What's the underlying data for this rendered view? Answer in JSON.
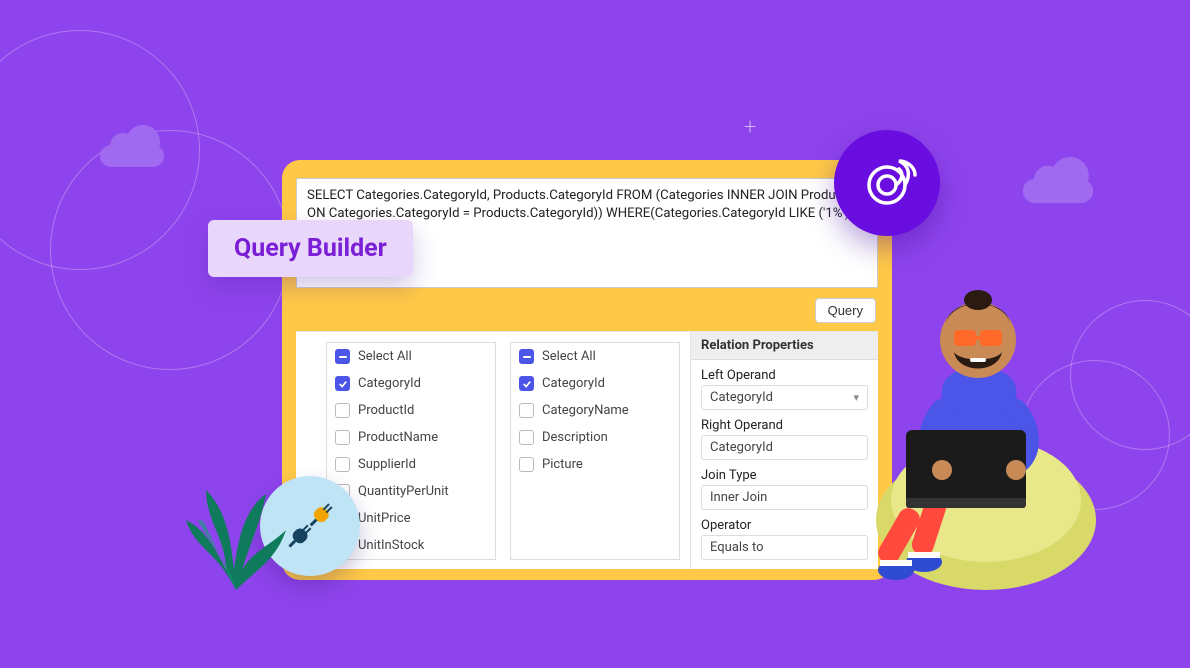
{
  "title_pill": "Query Builder",
  "sql_text": "SELECT Categories.CategoryId, Products.CategoryId FROM (Categories INNER JOIN Products ON Categories.CategoryId = Products.CategoryId)) WHERE(Categories.CategoryId LIKE ('1%'))",
  "query_button": "Query",
  "columns": {
    "left": {
      "select_all": "Select All",
      "items": [
        {
          "label": "CategoryId",
          "checked": true
        },
        {
          "label": "ProductId",
          "checked": false
        },
        {
          "label": "ProductName",
          "checked": false
        },
        {
          "label": "SupplierId",
          "checked": false
        },
        {
          "label": "QuantityPerUnit",
          "checked": false
        },
        {
          "label": "UnitPrice",
          "checked": false
        },
        {
          "label": "UnitInStock",
          "checked": false
        }
      ]
    },
    "right": {
      "select_all": "Select All",
      "items": [
        {
          "label": "CategoryId",
          "checked": true
        },
        {
          "label": "CategoryName",
          "checked": false
        },
        {
          "label": "Description",
          "checked": false
        },
        {
          "label": "Picture",
          "checked": false
        }
      ]
    }
  },
  "relation_panel": {
    "header": "Relation Properties",
    "left_operand": {
      "label": "Left Operand",
      "value": "CategoryId",
      "dropdown": true
    },
    "right_operand": {
      "label": "Right Operand",
      "value": "CategoryId",
      "dropdown": false
    },
    "join_type": {
      "label": "Join Type",
      "value": "Inner Join",
      "dropdown": false
    },
    "operator": {
      "label": "Operator",
      "value": "Equals to",
      "dropdown": false
    }
  }
}
